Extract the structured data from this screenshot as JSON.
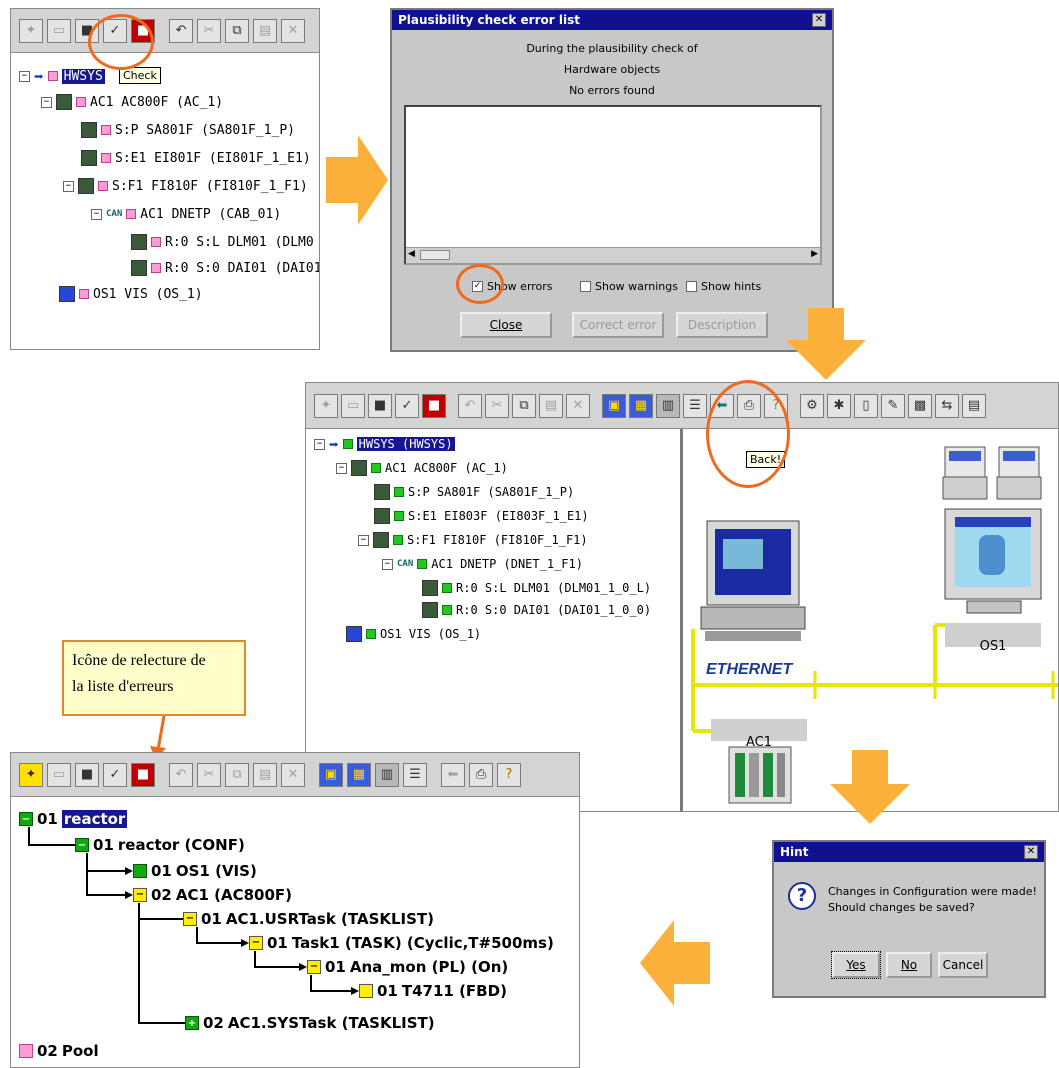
{
  "panel1": {
    "tooltip": "Check",
    "tree": [
      {
        "label": "HWSYS",
        "extra": ""
      },
      {
        "label": "AC1  AC800F (AC_1)"
      },
      {
        "label": "S:P  SA801F (SA801F_1_P)"
      },
      {
        "label": "S:E1  EI801F (EI801F_1_E1)"
      },
      {
        "label": "S:F1  FI810F (FI810F_1_F1)"
      },
      {
        "label": "AC1  DNETP (CAB_01)"
      },
      {
        "label": "R:0 S:L  DLM01 (DLM0"
      },
      {
        "label": "R:0 S:0  DAI01 (DAI01_"
      },
      {
        "label": "OS1  VIS (OS_1)"
      }
    ]
  },
  "dialog1": {
    "title": "Plausibility check error list",
    "line1": "During the plausibility check of",
    "line2": "Hardware objects",
    "line3": "No errors found",
    "chk_errors": "Show errors",
    "chk_warnings": "Show warnings",
    "chk_hints": "Show hints",
    "btn_close": "Close",
    "btn_correct": "Correct error",
    "btn_description": "Description"
  },
  "panel2": {
    "tooltip": "Back!",
    "tree": [
      {
        "label": "HWSYS (HWSYS)"
      },
      {
        "label": "AC1  AC800F (AC_1)"
      },
      {
        "label": "S:P  SA801F (SA801F_1_P)"
      },
      {
        "label": "S:E1  EI803F (EI803F_1_E1)"
      },
      {
        "label": "S:F1  FI810F (FI810F_1_F1)"
      },
      {
        "label": "AC1  DNETP (DNET_1_F1)"
      },
      {
        "label": "R:0 S:L  DLM01 (DLM01_1_0_L)"
      },
      {
        "label": "R:0 S:0  DAI01 (DAI01_1_0_0)"
      },
      {
        "label": "OS1  VIS (OS_1)"
      }
    ],
    "ethernet": "ETHERNET",
    "os_label": "OS1",
    "ac_label": "AC1"
  },
  "callout": {
    "line1": "Icône de relecture de",
    "line2": "la liste d'erreurs"
  },
  "panel3": {
    "tree": [
      {
        "num": "01",
        "label": "reactor"
      },
      {
        "num": "01",
        "label": "reactor (CONF)"
      },
      {
        "num": "01",
        "label": "OS1 (VIS)"
      },
      {
        "num": "02",
        "label": "AC1 (AC800F)"
      },
      {
        "num": "01",
        "label": "AC1.USRTask (TASKLIST)"
      },
      {
        "num": "01",
        "label": "Task1 (TASK) (Cyclic,T#500ms)"
      },
      {
        "num": "01",
        "label": "Ana_mon (PL) (On)"
      },
      {
        "num": "01",
        "label": "T4711 (FBD)"
      },
      {
        "num": "02",
        "label": "AC1.SYSTask (TASKLIST)"
      },
      {
        "num": "02",
        "label": "Pool"
      }
    ]
  },
  "hint": {
    "title": "Hint",
    "line1": "Changes in Configuration were made!",
    "line2": "Should changes be saved?",
    "yes": "Yes",
    "no": "No",
    "cancel": "Cancel"
  },
  "colors": {
    "flow_arrow": "#fbb03b",
    "highlight_circle": "#ee6a1d",
    "titlebar": "#101090"
  }
}
